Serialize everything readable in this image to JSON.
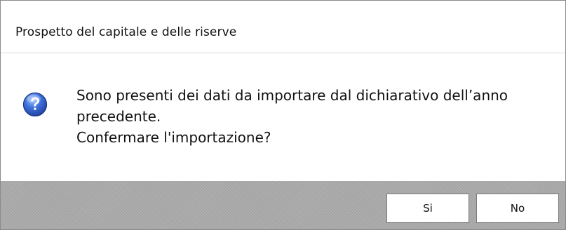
{
  "dialog": {
    "title": "Prospetto del capitale e delle riserve",
    "icon": "question-icon",
    "message_lines": [
      "Sono presenti dei dati da importare dal dichiarativo dell’anno",
      "precedente.",
      "Confermare l'importazione?"
    ],
    "buttons": {
      "yes_label": "Si",
      "no_label": "No"
    }
  },
  "colors": {
    "footer_bg": "#a9a9a9",
    "icon_blue": "#2b55c8",
    "border": "#8a8a8a"
  }
}
